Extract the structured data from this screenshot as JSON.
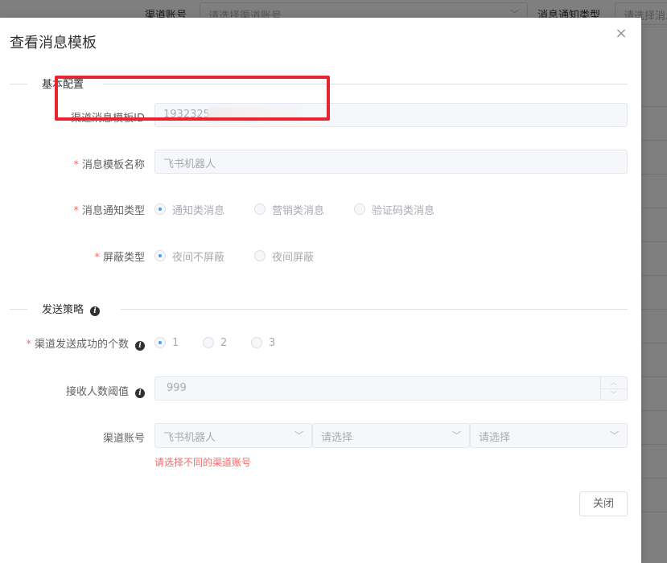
{
  "background": {
    "channel_account_label": "渠道账号",
    "channel_account_placeholder": "请选择渠道账号",
    "notify_type_label": "消息通知类型",
    "notify_type_placeholder": "请选择消息通知类型"
  },
  "dialog": {
    "title": "查看消息模板",
    "close_label": "关闭"
  },
  "sections": {
    "basic": "基本配置",
    "strategy": "发送策略"
  },
  "fields": {
    "template_id": {
      "label": "渠道消息模板ID",
      "value": "1932325"
    },
    "template_name": {
      "label": "消息模板名称",
      "value": "飞书机器人"
    },
    "notify_type": {
      "label": "消息通知类型",
      "options": [
        "通知类消息",
        "营销类消息",
        "验证码类消息"
      ],
      "selected": 0
    },
    "block_type": {
      "label": "屏蔽类型",
      "options": [
        "夜间不屏蔽",
        "夜间屏蔽"
      ],
      "selected": 0
    },
    "success_count": {
      "label": "渠道发送成功的个数",
      "options": [
        "1",
        "2",
        "3"
      ],
      "selected": 0
    },
    "threshold": {
      "label": "接收人数阈值",
      "value": "999"
    },
    "channel_account": {
      "label": "渠道账号",
      "selects": [
        "飞书机器人",
        "请选择",
        "请选择"
      ],
      "error": "请选择不同的渠道账号"
    }
  },
  "colors": {
    "primary": "#409eff",
    "danger": "#f56c6c",
    "highlight": "#e8252e"
  }
}
